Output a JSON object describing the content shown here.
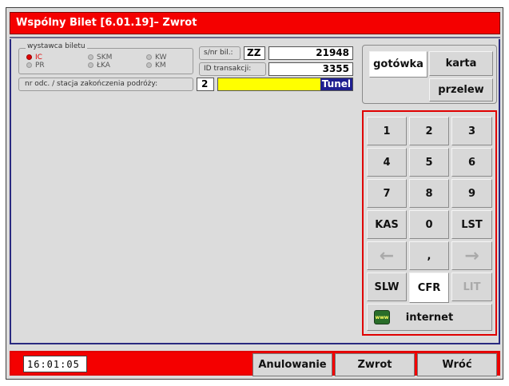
{
  "window": {
    "title": "Wspólny Bilet  [6.01.19]– Zwrot"
  },
  "issuer": {
    "legend": "wystawca biletu",
    "options": [
      {
        "label": "IC",
        "selected": true
      },
      {
        "label": "SKM",
        "selected": false
      },
      {
        "label": "KW",
        "selected": false
      },
      {
        "label": "PR",
        "selected": false
      },
      {
        "label": "ŁKA",
        "selected": false
      },
      {
        "label": "KM",
        "selected": false
      }
    ]
  },
  "ticket": {
    "snr_label": "s/nr bil.:",
    "series": "ZZ",
    "number": "21948",
    "txn_label": "ID transakcji:",
    "txn_id": "3355"
  },
  "station": {
    "label": "nr odc. / stacja zakończenia podróży:",
    "segment": "2",
    "name": "Tunel"
  },
  "payment": {
    "cash": "gotówka",
    "card": "karta",
    "transfer": "przelew"
  },
  "keypad": {
    "rows": [
      [
        "1",
        "2",
        "3"
      ],
      [
        "4",
        "5",
        "6"
      ],
      [
        "7",
        "8",
        "9"
      ],
      [
        "KAS",
        "0",
        "LST"
      ],
      [
        "←",
        ",",
        "→"
      ],
      [
        "SLW",
        "CFR",
        "LIT"
      ]
    ],
    "internet": "internet",
    "www_badge": "www"
  },
  "footer": {
    "clock": "16:01:05",
    "cancel": "Anulowanie",
    "refund": "Zwrot",
    "back": "Wróć"
  },
  "colors": {
    "title_bar": "#f40000",
    "keypad_border": "#e00000",
    "station_field": "#ffff00",
    "highlight": "#1e1e90"
  }
}
